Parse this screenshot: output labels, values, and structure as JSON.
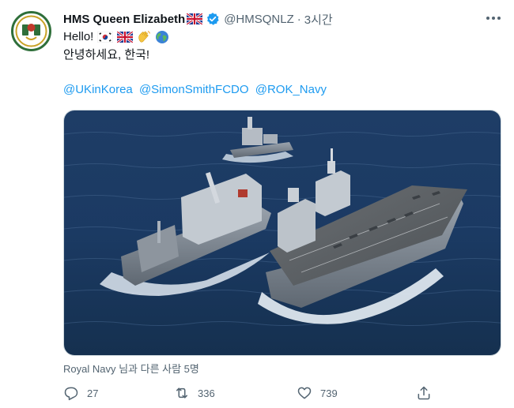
{
  "tweet": {
    "display_name": "HMS Queen Elizabeth",
    "handle": "@HMSQNLZ",
    "dot": "·",
    "time": "3시간",
    "line1_text": "Hello!",
    "line2_text": "안녕하세요, 한국!",
    "mentions": [
      "@UKinKorea",
      "@SimonSmithFCDO",
      "@ROK_Navy"
    ],
    "tagged_text": "Royal Navy 님과 다른 사람 5명"
  },
  "actions": {
    "reply_count": "27",
    "retweet_count": "336",
    "like_count": "739"
  },
  "colors": {
    "link": "#1d9bf0",
    "secondary_text": "#536471",
    "sea": "#1c3d6b",
    "verified": "#1d9bf0"
  },
  "icons": [
    "avatar-crest",
    "uk-flag-icon",
    "verified-badge-icon",
    "more-options-icon",
    "korea-flag-icon",
    "waving-hand-icon",
    "globe-icon",
    "reply-icon",
    "retweet-icon",
    "like-icon",
    "share-icon"
  ]
}
